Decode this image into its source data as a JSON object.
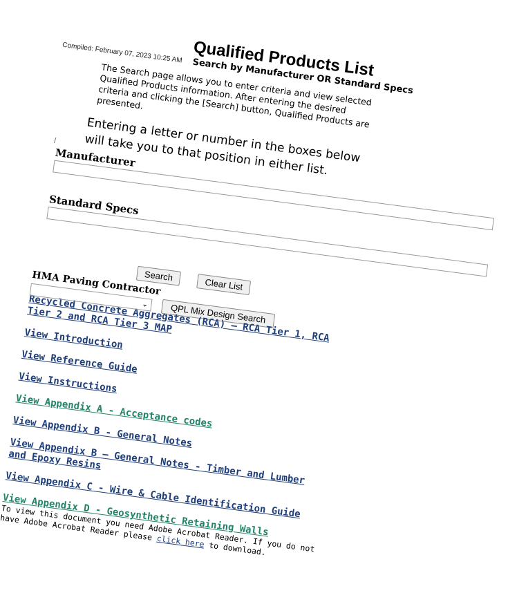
{
  "page": {
    "title": "Qualified Products List",
    "compiled": "Compiled: February 07, 2023 10:25 AM",
    "subtitle": "Search by Manufacturer OR Standard Specs",
    "description": "The Search page allows you to enter criteria and view selected Qualified Products information. After entering the desired criteria and clicking the [Search] button, Qualified Products are presented.",
    "instruction": "Entering a letter or number in the boxes below will take you to that position in either list."
  },
  "form": {
    "manufacturer_label": "Manufacturer",
    "manufacturer_value": "",
    "standard_specs_label": "Standard Specs",
    "standard_specs_value": "",
    "search_button": "Search",
    "clear_button": "Clear List",
    "hma_label": "HMA Paving Contractor",
    "hma_selected": "",
    "qpl_button": "QPL Mix Design Search"
  },
  "links": [
    {
      "label": "Recycled Concrete Aggregates (RCA) – RCA Tier 1, RCA Tier 2 and RCA Tier 3 MAP",
      "color": "#1f3f7a"
    },
    {
      "label": "View Introduction",
      "color": "#1f3f7a"
    },
    {
      "label": "View Reference Guide",
      "color": "#1f3f7a"
    },
    {
      "label": "View Instructions",
      "color": "#1f3f7a"
    },
    {
      "label": "View Appendix A - Acceptance codes",
      "color": "#23846a"
    },
    {
      "label": "View Appendix B - General Notes",
      "color": "#1f3f7a"
    },
    {
      "label": "View Appendix B – General Notes - Timber and Lumber and Epoxy Resins",
      "color": "#1f3f7a"
    },
    {
      "label": "View Appendix C - Wire & Cable Identification Guide",
      "color": "#1f3f7a"
    },
    {
      "label": "View Appendix D - Geosynthetic Retaining Walls",
      "color": "#23846a"
    }
  ],
  "footer": {
    "text_before": "To view this document you need Adobe Acrobat Reader. If you do not have Adobe Acrobat Reader please ",
    "link": "click here",
    "text_after": " to download."
  }
}
